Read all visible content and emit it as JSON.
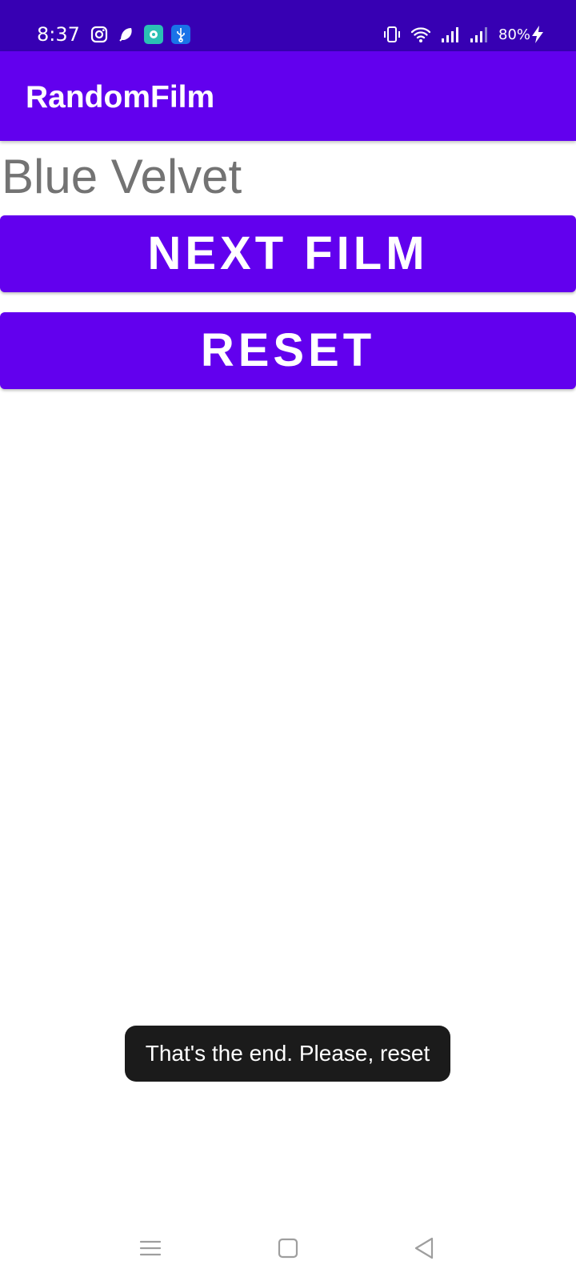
{
  "status_bar": {
    "time": "8:37",
    "battery": "80%",
    "left_icons": [
      "instagram-icon",
      "notification-app-icon",
      "teal-app-icon",
      "usb-icon"
    ],
    "right_icons": [
      "vibrate-icon",
      "wifi-icon",
      "signal-icon",
      "signal-icon",
      "charging-icon"
    ],
    "background": "#3700b3"
  },
  "app_bar": {
    "title": "RandomFilm",
    "background": "#6200ee"
  },
  "main": {
    "film_title": "Blue Velvet",
    "next_button_label": "NEXT FILM",
    "reset_button_label": "RESET",
    "button_color": "#6200ee"
  },
  "toast": {
    "message": "That's the end. Please, reset"
  },
  "nav_bar": {
    "icons": [
      "menu-icon",
      "home-icon",
      "back-icon"
    ]
  }
}
